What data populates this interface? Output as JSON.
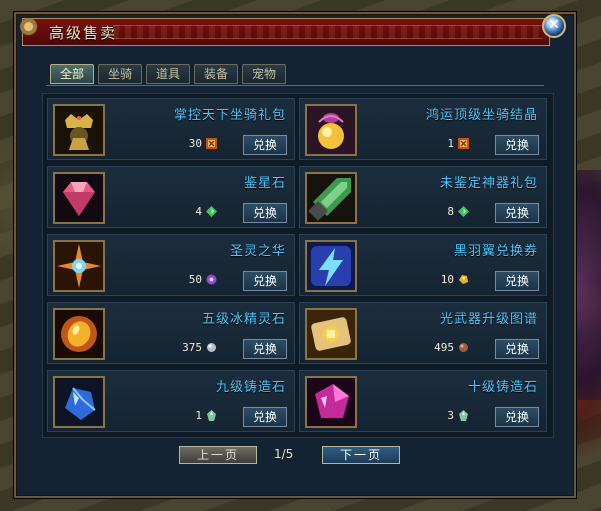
{
  "window": {
    "title": "高级售卖",
    "close_symbol": "✕"
  },
  "tabs": [
    {
      "label": "全部",
      "active": true
    },
    {
      "label": "坐骑",
      "active": false
    },
    {
      "label": "道具",
      "active": false
    },
    {
      "label": "装备",
      "active": false
    },
    {
      "label": "宠物",
      "active": false
    }
  ],
  "items": [
    {
      "name": "掌控天下坐骑礼包",
      "price": "30",
      "currency": "vip-coin-icon",
      "button": "兑换",
      "icon": "crown-mount-pack-icon"
    },
    {
      "name": "鸿运顶级坐骑结晶",
      "price": "1",
      "currency": "vip-coin-icon",
      "button": "兑换",
      "icon": "golden-orb-icon"
    },
    {
      "name": "鉴星石",
      "price": "4",
      "currency": "green-gem-icon",
      "button": "兑换",
      "icon": "pink-diamond-icon"
    },
    {
      "name": "未鉴定神器礼包",
      "price": "8",
      "currency": "green-gem-icon",
      "button": "兑换",
      "icon": "jade-sword-icon"
    },
    {
      "name": "圣灵之华",
      "price": "50",
      "currency": "purple-flower-icon",
      "button": "兑换",
      "icon": "holy-star-icon"
    },
    {
      "name": "黑羽翼兑换券",
      "price": "10",
      "currency": "gold-nugget-icon",
      "button": "兑换",
      "icon": "lightning-ticket-icon"
    },
    {
      "name": "五级冰精灵石",
      "price": "375",
      "currency": "silver-stone-icon",
      "button": "兑换",
      "icon": "orange-spirit-stone-icon"
    },
    {
      "name": "光武器升级图谱",
      "price": "495",
      "currency": "bronze-stone-icon",
      "button": "兑换",
      "icon": "scroll-map-icon"
    },
    {
      "name": "九级铸造石",
      "price": "1",
      "currency": "crystal-green-icon",
      "button": "兑换",
      "icon": "blue-forge-stone-icon"
    },
    {
      "name": "十级铸造石",
      "price": "3",
      "currency": "crystal-green-icon",
      "button": "兑换",
      "icon": "pink-forge-stone-icon"
    }
  ],
  "pager": {
    "prev_label": "上一页",
    "next_label": "下一页",
    "page_text": "1/5"
  },
  "colors": {
    "item_name": "#4fc3f7",
    "title_bar": "#7a1010",
    "panel": "#142333"
  }
}
